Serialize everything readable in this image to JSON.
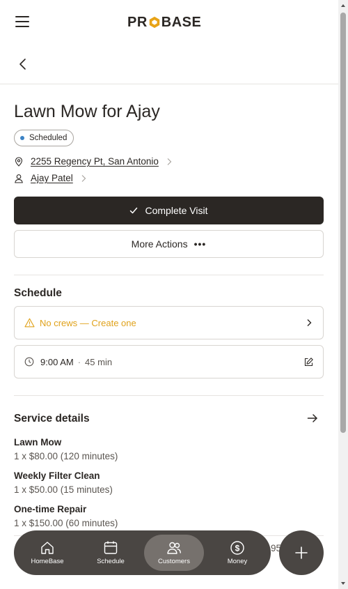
{
  "header": {
    "logo_text_left": "PR",
    "logo_text_right": "BASE",
    "menu_icon": "hamburger-icon",
    "back_icon": "chevron-left-icon"
  },
  "visit": {
    "title": "Lawn Mow for Ajay",
    "status": "Scheduled",
    "status_color": "#3b82c4",
    "address": "2255 Regency Pt, San Antonio",
    "customer": "Ajay Patel"
  },
  "actions": {
    "complete_label": "Complete Visit",
    "more_label": "More Actions",
    "more_dots": "•••"
  },
  "schedule": {
    "heading": "Schedule",
    "crew_warning": "No crews — Create one",
    "warning_color": "#e0a21b",
    "time": "9:00 AM",
    "separator": "·",
    "duration": "45 min"
  },
  "services": {
    "heading": "Service details",
    "items": [
      {
        "name": "Lawn Mow",
        "detail": "1 x $80.00 (120 minutes)"
      },
      {
        "name": "Weekly Filter Clean",
        "detail": "1 x $50.00 (15 minutes)"
      },
      {
        "name": "One-time Repair",
        "detail": "1 x $150.00 (60 minutes)"
      }
    ],
    "partial_total": "95"
  },
  "bottom_nav": {
    "items": [
      {
        "label": "HomeBase",
        "icon": "home-icon"
      },
      {
        "label": "Schedule",
        "icon": "calendar-icon"
      },
      {
        "label": "Customers",
        "icon": "users-icon",
        "active": true
      },
      {
        "label": "Money",
        "icon": "dollar-icon"
      }
    ],
    "fab_icon": "plus-icon"
  },
  "colors": {
    "dark": "#2b2724",
    "nav_bg": "#4a4643",
    "nav_active": "#76716d",
    "logo_accent": "#e8a317"
  }
}
